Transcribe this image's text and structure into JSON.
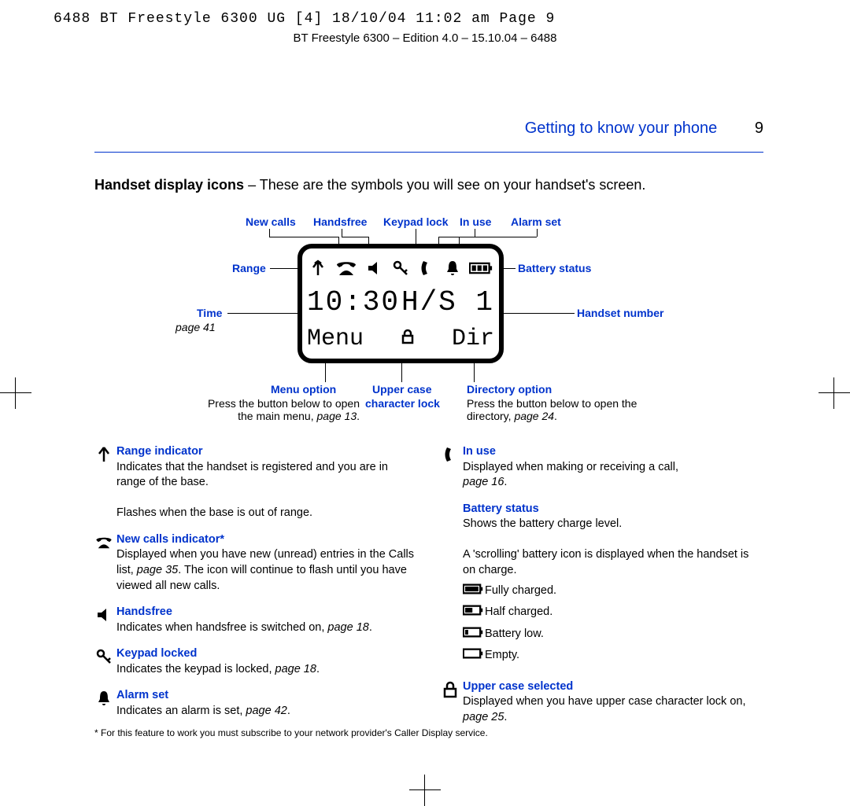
{
  "slug": "6488 BT Freestyle 6300 UG [4]  18/10/04  11:02 am  Page 9",
  "edition_line": "BT Freestyle 6300 – Edition 4.0 – 15.10.04 – 6488",
  "section_title": "Getting to know your phone",
  "page_number": "9",
  "intro_heading": "Handset display icons",
  "intro_rest": " – These are the symbols you will see on your handset's screen.",
  "callouts": {
    "top_row": [
      "New calls",
      "Handsfree",
      "Keypad lock",
      "In use",
      "Alarm set"
    ],
    "range": "Range",
    "battery": "Battery status",
    "time": "Time",
    "time_page": "page 41",
    "handset_no": "Handset number",
    "menu": "Menu option",
    "menu_body1": "Press the button below to open",
    "menu_body2": "the main menu, ",
    "menu_page": "page 13",
    "uppercase1": "Upper case",
    "uppercase2": "character lock",
    "directory": "Directory option",
    "directory_body1": "Press the button below to open the",
    "directory_body2": "directory, ",
    "directory_page": "page 24"
  },
  "lcd": {
    "time": "10:30",
    "handset": "H/S 1",
    "menu": "Menu",
    "dir": "Dir"
  },
  "defs_left": [
    {
      "icon": "range",
      "heading": "Range indicator",
      "body": "Indicates that the handset is registered and you are in range of the base.",
      "extra": "Flashes when the base is out of range."
    },
    {
      "icon": "newcalls",
      "heading": "New calls indicator*",
      "body": "Displayed when you have new (unread) entries in the Calls list, ",
      "page": "page 35",
      "tail": ". The icon will continue to flash until you have viewed all new calls."
    },
    {
      "icon": "handsfree",
      "heading": "Handsfree",
      "body": "Indicates when handsfree is switched on, ",
      "page": "page 18",
      "tail": "."
    },
    {
      "icon": "keypad",
      "heading": "Keypad locked",
      "body": "Indicates the keypad is locked, ",
      "page": "page 18",
      "tail": "."
    },
    {
      "icon": "alarm",
      "heading": "Alarm set",
      "body": "Indicates an alarm is set, ",
      "page": "page 42",
      "tail": "."
    }
  ],
  "defs_right_inuse": {
    "heading": "In use",
    "body": "Displayed when making or receiving a call, ",
    "page": "page 16",
    "tail": "."
  },
  "defs_right_battery": {
    "heading": "Battery status",
    "body1": "Shows the battery charge level.",
    "body2": "A 'scrolling' battery icon is displayed when the handset is on charge.",
    "levels": [
      {
        "icon": "bat-full",
        "label": "Fully charged."
      },
      {
        "icon": "bat-half",
        "label": "Half charged."
      },
      {
        "icon": "bat-low",
        "label": "Battery low."
      },
      {
        "icon": "bat-empty",
        "label": "Empty."
      }
    ]
  },
  "defs_right_upper": {
    "heading": "Upper case selected",
    "body": "Displayed when you have upper case character lock on, ",
    "page": "page 25",
    "tail": "."
  },
  "footnote": "*  For this feature to work you must subscribe to your network provider's Caller Display service."
}
